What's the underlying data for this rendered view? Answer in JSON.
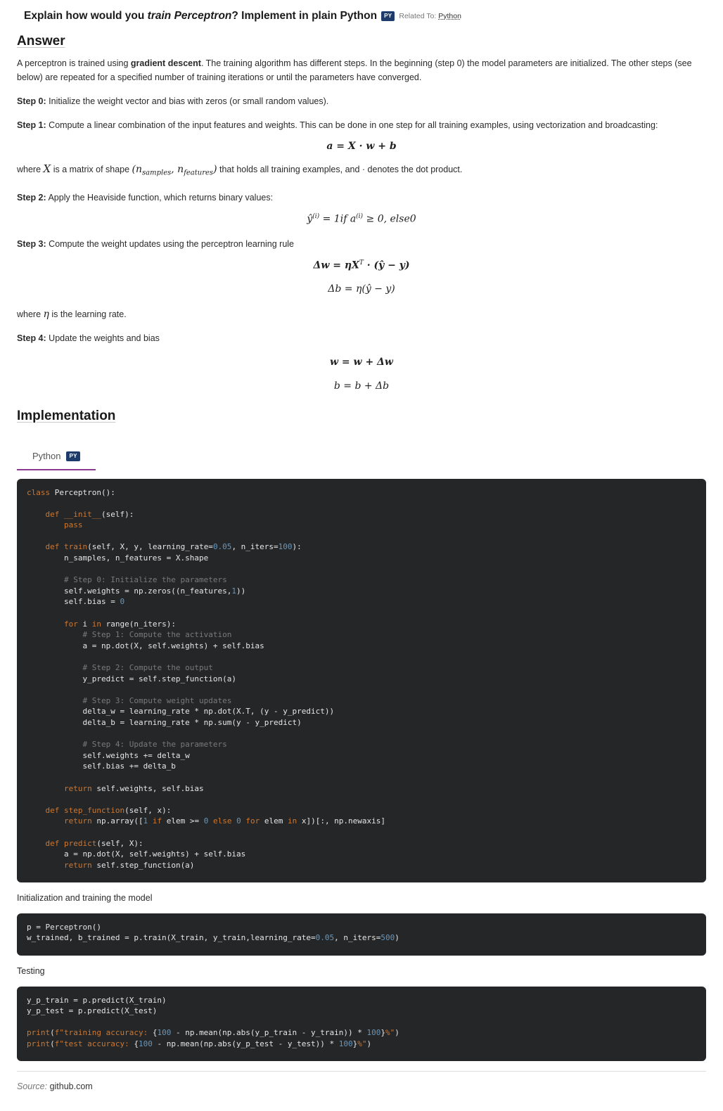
{
  "question": {
    "prefix": "Explain how would you ",
    "emphasis": "train Perceptron",
    "suffix": "? Implement in plain Python",
    "badge": "PY",
    "related_label": "Related To:",
    "related_link": "Python"
  },
  "answer": {
    "heading": "Answer",
    "intro_1": "A perceptron is trained using ",
    "intro_bold": "gradient descent",
    "intro_2": ". The training algorithm has different steps. In the beginning (step 0) the model parameters are initialized. The other steps (see below) are repeated for a specified number of training iterations or until the parameters have converged.",
    "step0_label": "Step 0:",
    "step0_text": " Initialize the weight vector and bias with zeros (or small random values).",
    "step1_label": "Step 1:",
    "step1_text": " Compute a linear combination of the input features and weights. This can be done in one step for all training examples, using vectorization and broadcasting:",
    "eq1": "a = X · w + b",
    "where1_a": "where ",
    "where1_x": "X",
    "where1_b": " is a matrix of shape ",
    "where1_shape": "(n",
    "where1_sub1": "samples",
    "where1_comma": ", n",
    "where1_sub2": "features",
    "where1_close": ")",
    "where1_c": " that holds all training examples, and · denotes the dot product.",
    "step2_label": "Step 2:",
    "step2_text": " Apply the Heaviside function, which returns binary values:",
    "eq2_left": "ŷ",
    "eq2_sup1": "(i)",
    "eq2_mid": " = 1if a",
    "eq2_sup2": "(i)",
    "eq2_right": " ≥ 0, else0",
    "step3_label": "Step 3:",
    "step3_text": " Compute the weight updates using the perceptron learning rule",
    "eq3a_left": "Δw = ηX",
    "eq3a_sup": "T",
    "eq3a_right": " · (ŷ − y)",
    "eq3b": "Δb = η(ŷ − y)",
    "where2_a": "where ",
    "where2_eta": "η",
    "where2_b": " is the learning rate.",
    "step4_label": "Step 4:",
    "step4_text": " Update the weights and bias",
    "eq4a": "w = w + Δw",
    "eq4b": "b = b + Δb"
  },
  "implementation": {
    "heading": "Implementation",
    "tab_label": "Python",
    "tab_badge": "PY",
    "init_caption": "Initialization and training the model",
    "testing_caption": "Testing"
  },
  "source": {
    "label": "Source:",
    "value": " github.com"
  }
}
